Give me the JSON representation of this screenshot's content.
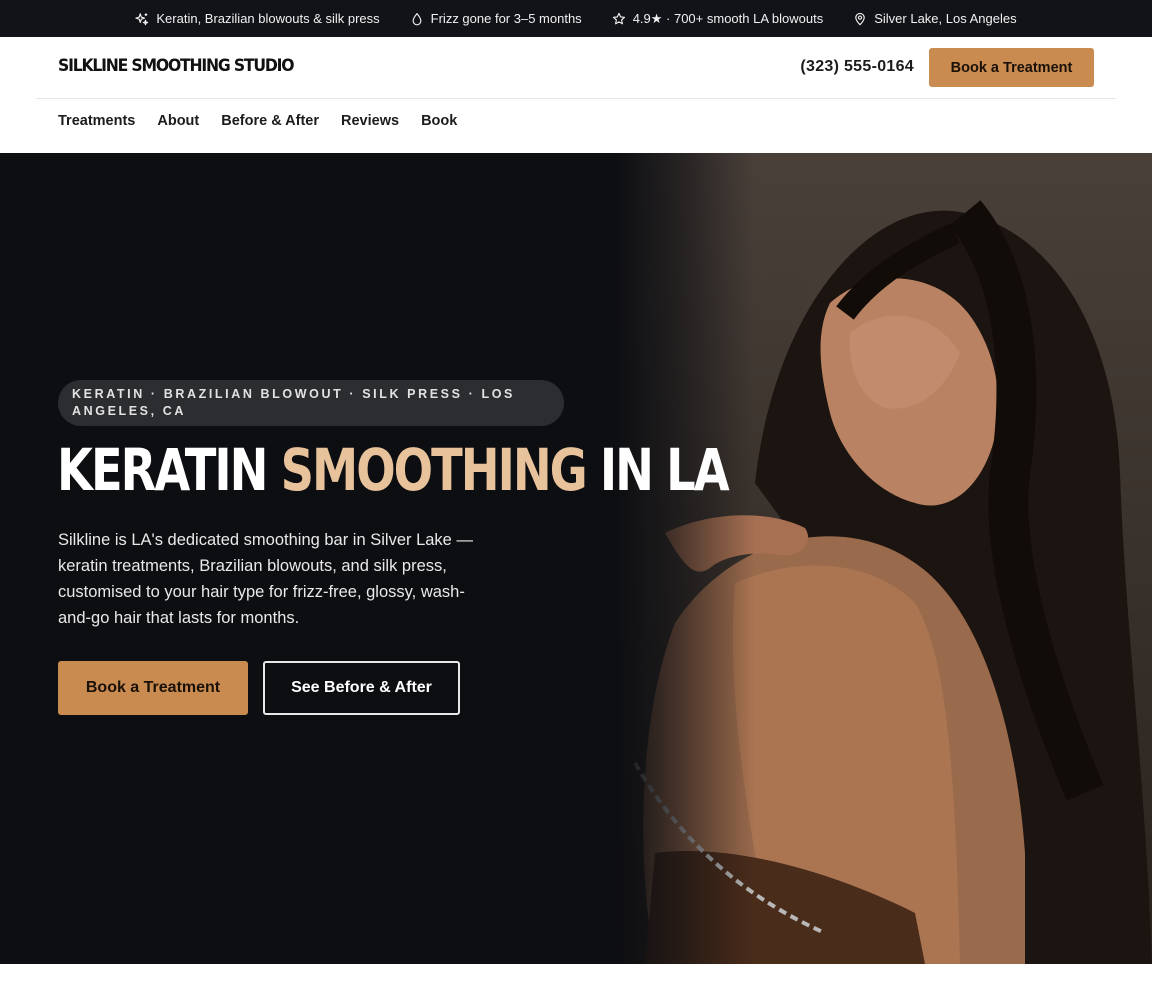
{
  "topbar": {
    "items": [
      {
        "icon": "sparkle-icon",
        "text": "Keratin, Brazilian blowouts & silk press"
      },
      {
        "icon": "droplet-icon",
        "text": "Frizz gone for 3–5 months"
      },
      {
        "icon": "star-icon",
        "text": "4.9★ · 700+ smooth LA blowouts"
      },
      {
        "icon": "map-pin-icon",
        "text": "Silver Lake, Los Angeles"
      }
    ]
  },
  "header": {
    "logo": "SILKLINE SMOOTHING STUDIO",
    "phone": "(323) 555-0164",
    "cta_label": "Book a Treatment"
  },
  "nav": {
    "items": [
      "Treatments",
      "About",
      "Before & After",
      "Reviews",
      "Book"
    ]
  },
  "hero": {
    "eyebrow": "KERATIN · BRAZILIAN BLOWOUT · SILK PRESS · LOS ANGELES, CA",
    "headline": {
      "part1": "KERATIN ",
      "accent": "SMOOTHING",
      "part2": " IN LA"
    },
    "lede": "Silkline is LA's dedicated smoothing bar in Silver Lake — keratin treatments, Brazilian blowouts, and silk press, customised to your hair type for frizz-free, glossy, wash-and-go hair that lasts for months.",
    "primary_cta": "Book a Treatment",
    "secondary_cta": "See Before & After"
  },
  "colors": {
    "topbar_bg": "#121318",
    "hero_bg": "#0d0e12",
    "accent": "#c98b50",
    "headline_accent": "#e7c29a"
  }
}
